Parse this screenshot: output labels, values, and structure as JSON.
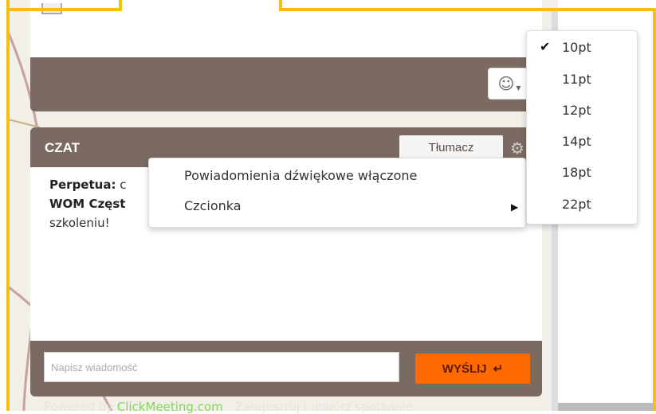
{
  "toolbar": {
    "emoji_icon": "smiley-icon"
  },
  "chat": {
    "title": "CZAT",
    "translate_label": "Tłumacz",
    "messages": [
      {
        "author": "Perpetua:",
        "text": "c"
      },
      {
        "author": "WOM Częst",
        "text": ""
      }
    ],
    "message_tail": "szkoleniu!",
    "input_placeholder": "Napisz wiadomość",
    "send_label": "WYŚLIJ",
    "send_icon": "enter-arrow-icon"
  },
  "footer": {
    "powered_text": "Powered by ",
    "link_text": "ClickMeeting.com",
    "rest_text": " - Zarejestruj i utwórz spotkanie"
  },
  "context_menu": {
    "items": [
      "Powiadomienia dźwiękowe włączone",
      "Czcionka"
    ]
  },
  "font_menu": {
    "options": [
      "10pt",
      "11pt",
      "12pt",
      "14pt",
      "18pt",
      "22pt"
    ],
    "selected": "10pt"
  },
  "colors": {
    "panel": "#7a6a62",
    "send": "#ff6a00",
    "frame": "#f4bf0d"
  }
}
